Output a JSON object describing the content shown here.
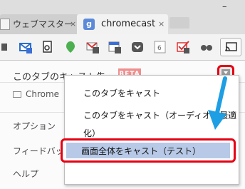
{
  "tabs": [
    {
      "label": "ウェブマスター",
      "close": "×"
    },
    {
      "label": "chromecast",
      "close": "×",
      "favicon": "g"
    }
  ],
  "window_controls": {
    "minimize": "–"
  },
  "toolbar": {
    "icons": [
      "extension-icon",
      "mail-icon",
      "docs-icon",
      "pin-icon",
      "gmail-icon",
      "calendar-icon",
      "pocket-icon",
      "google-plus-icon",
      "todo-icon",
      "reader-icon",
      "cast-icon"
    ]
  },
  "popup": {
    "title": "このタブのキャスト先...",
    "beta_badge": "BETA",
    "device": "Chrome",
    "side_items": [
      "オプション",
      "フィードバッ",
      "ヘルプ"
    ]
  },
  "menu": {
    "items": [
      "このタブをキャスト",
      "このタブをキャスト（オーディオに最適",
      "化）"
    ],
    "selected_item": "画面全体をキャスト（テスト）"
  },
  "colors": {
    "highlight_red": "#e60012",
    "selection_blue": "#b7c9e6",
    "beta_pink": "#ef8f8f",
    "arrow_blue": "#1e9ee3"
  }
}
